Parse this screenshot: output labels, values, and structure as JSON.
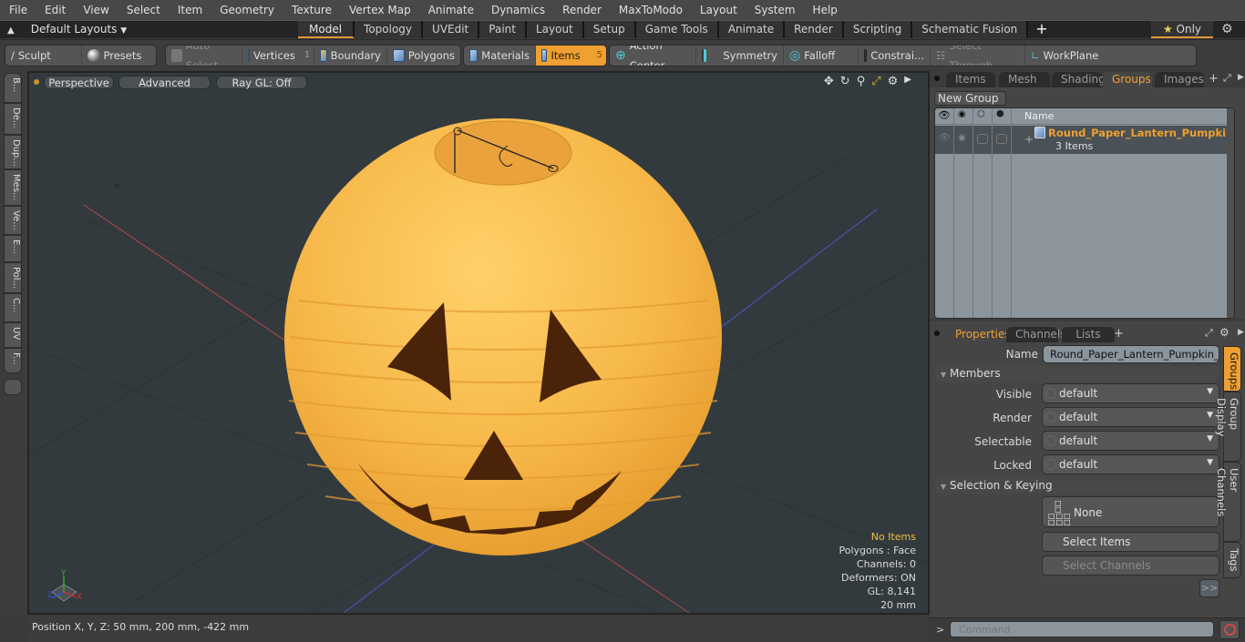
{
  "menubar": {
    "items": [
      "File",
      "Edit",
      "View",
      "Select",
      "Item",
      "Geometry",
      "Texture",
      "Vertex Map",
      "Animate",
      "Dynamics",
      "Render",
      "MaxToModo",
      "Layout",
      "System",
      "Help"
    ]
  },
  "layoutbar": {
    "layouts_label": "Default Layouts",
    "tabs": [
      "Model",
      "Topology",
      "UVEdit",
      "Paint",
      "Layout",
      "Setup",
      "Game Tools",
      "Animate",
      "Render",
      "Scripting",
      "Schematic Fusion"
    ],
    "active_tab": "Model",
    "add_label": "+",
    "only_label": "Only"
  },
  "toolbar": {
    "sculpt": "Sculpt",
    "presets": "Presets",
    "auto_select": "Auto Select",
    "vertices": "Vertices",
    "vertices_count": "1",
    "boundary": "Boundary",
    "polygons": "Polygons",
    "materials": "Materials",
    "items": "Items",
    "items_count": "5",
    "action_center": "Action Center",
    "symmetry": "Symmetry",
    "falloff": "Falloff",
    "constraints": "Constrai...",
    "select_through": "Select Through",
    "workplane": "WorkPlane"
  },
  "left_strip": {
    "tabs": [
      "B...",
      "De...",
      "Dup...",
      "Mes...",
      "Ve...",
      "E...",
      "Pol...",
      "C...",
      "UV",
      "F..."
    ]
  },
  "viewport": {
    "view_mode": "Perspective",
    "shading": "Advanced",
    "raygl": "Ray GL: Off",
    "stats": {
      "selection": "No Items",
      "polygons": "Polygons : Face",
      "channels": "Channels: 0",
      "deformers": "Deformers: ON",
      "gl": "GL: 8,141",
      "scale": "20 mm"
    },
    "axis_labels": {
      "x": "X",
      "y": "Y",
      "z": "Z"
    },
    "colors": {
      "lantern": "#f5b347",
      "face": "#4a2308",
      "background": "#333a3e"
    }
  },
  "statusbar": {
    "position": "Position X, Y, Z:   50 mm, 200 mm, -422 mm"
  },
  "top_panel": {
    "tabs": [
      "Items",
      "Mesh ...",
      "Shading",
      "Groups",
      "Images"
    ],
    "active_tab": "Groups",
    "new_group": "New Group",
    "column_name": "Name",
    "groups": [
      {
        "name": "Round_Paper_Lantern_Pumpkin...",
        "count": "3 Items"
      }
    ]
  },
  "properties_panel": {
    "tabs": [
      "Properties",
      "Channels",
      "Lists"
    ],
    "active_tab": "Properties",
    "name_label": "Name",
    "name_value": "Round_Paper_Lantern_Pumpkin_Head",
    "members_section": "Members",
    "fields": [
      {
        "label": "Visible",
        "value": "default"
      },
      {
        "label": "Render",
        "value": "default"
      },
      {
        "label": "Selectable",
        "value": "default"
      },
      {
        "label": "Locked",
        "value": "default"
      }
    ],
    "selection_section": "Selection & Keying",
    "none_label": "None",
    "select_items": "Select Items",
    "select_channels": "Select Channels",
    "more": ">>",
    "side_tabs": [
      "Groups",
      "Group Display",
      "User Channels",
      "Tags"
    ],
    "active_side_tab": "Groups"
  },
  "command": {
    "prompt": ">",
    "placeholder": "Command"
  }
}
